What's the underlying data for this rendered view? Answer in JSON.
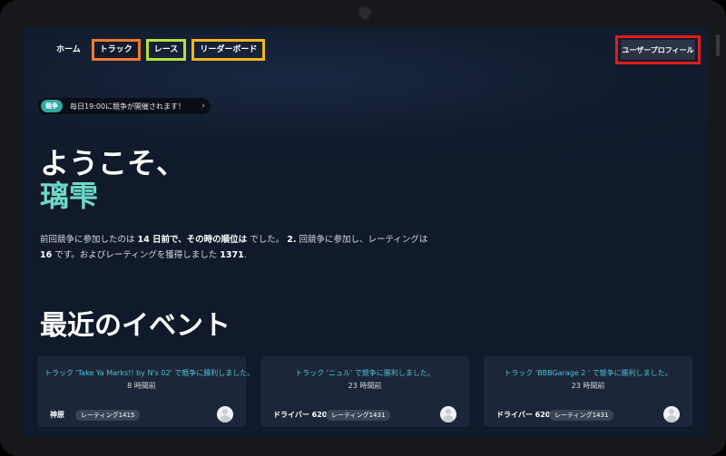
{
  "nav": {
    "home": "ホーム",
    "track": "トラック",
    "race": "レース",
    "leaderboard": "リーダーボード",
    "profile": "ユーザープロフィール"
  },
  "highlight_colors": {
    "track": "#f07a2f",
    "race": "#b6e03d",
    "leaderboard": "#f2b51e",
    "profile": "#e21b1b"
  },
  "announcement": {
    "tag": "競争",
    "text": "毎日19:00に競争が開催されます！",
    "arrow": "›"
  },
  "welcome": {
    "greeting": "ようこそ、",
    "username": "璃雫"
  },
  "summary": {
    "p1": "前回競争に参加したのは ",
    "days": "14 日前で、その時の順位は",
    "p2": " でした。",
    "rank": "2.",
    "p3": " 回競争に参加し、レーティングは",
    "rating": "16",
    "p4": " です。およびレーティングを獲得しました ",
    "gained": "1371",
    "p5": "."
  },
  "recent": {
    "title": "最近のイベント",
    "cards": [
      {
        "title": "トラック 'Take Ya Marks!! by N's 02' で競争に勝利しました。",
        "time": "8 時間前",
        "user": "神原",
        "badge": "レーティング1415"
      },
      {
        "title": "トラック 'ニュル' で競争に勝利しました。",
        "time": "23 時間前",
        "user": "ドライバー 6207",
        "badge": "レーティング1431"
      },
      {
        "title": "トラック 'BBBGarage 2 ' で競争に勝利しました。",
        "time": "23 時間前",
        "user": "ドライバー 6207",
        "badge": "レーティング1431"
      }
    ]
  }
}
